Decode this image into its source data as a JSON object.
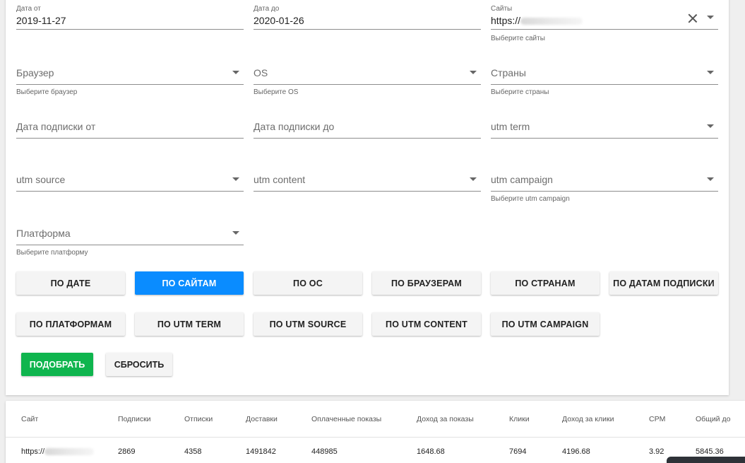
{
  "filters": {
    "date_from": {
      "label": "Дата от",
      "value": "2019-11-27"
    },
    "date_to": {
      "label": "Дата до",
      "value": "2020-01-26"
    },
    "sites": {
      "label": "Сайты",
      "value": "https://",
      "hint": "Выберите сайты"
    },
    "browser": {
      "placeholder": "Браузер",
      "hint": "Выберите браузер"
    },
    "os": {
      "placeholder": "OS",
      "hint": "Выберите OS"
    },
    "countries": {
      "placeholder": "Страны",
      "hint": "Выберите страны"
    },
    "sub_date_from": {
      "placeholder": "Дата подписки от"
    },
    "sub_date_to": {
      "placeholder": "Дата подписки до"
    },
    "utm_term": {
      "placeholder": "utm term"
    },
    "utm_source": {
      "placeholder": "utm source"
    },
    "utm_content": {
      "placeholder": "utm content"
    },
    "utm_campaign": {
      "placeholder": "utm campaign",
      "hint": "Выберите utm campaign"
    },
    "platform": {
      "placeholder": "Платформа",
      "hint": "Выберите платформу"
    }
  },
  "group_buttons": [
    "ПО ДАТЕ",
    "ПО САЙТАМ",
    "ПО ОС",
    "ПО БРАУЗЕРАМ",
    "ПО СТРАНАМ",
    "ПО ДАТАМ ПОДПИСКИ",
    "ПО ПЛАТФОРМАМ",
    "ПО UTM TERM",
    "ПО UTM SOURCE",
    "ПО UTM CONTENT",
    "ПО UTM CAMPAIGN"
  ],
  "active_group": "ПО САЙТАМ",
  "actions": {
    "apply": "ПОДОБРАТЬ",
    "reset": "СБРОСИТЬ"
  },
  "colors": {
    "active_group": "#0a8cff",
    "apply": "#0fb54e"
  },
  "table": {
    "columns": [
      "Сайт",
      "Подписки",
      "Отписки",
      "Доставки",
      "Оплаченные показы",
      "Доход за показы",
      "Клики",
      "Доход за клики",
      "CPM",
      "Общий до"
    ],
    "rows": [
      [
        "https://",
        "2869",
        "4358",
        "1491842",
        "448985",
        "1648.68",
        "7694",
        "4196.68",
        "3.92",
        "5845.36"
      ]
    ]
  }
}
